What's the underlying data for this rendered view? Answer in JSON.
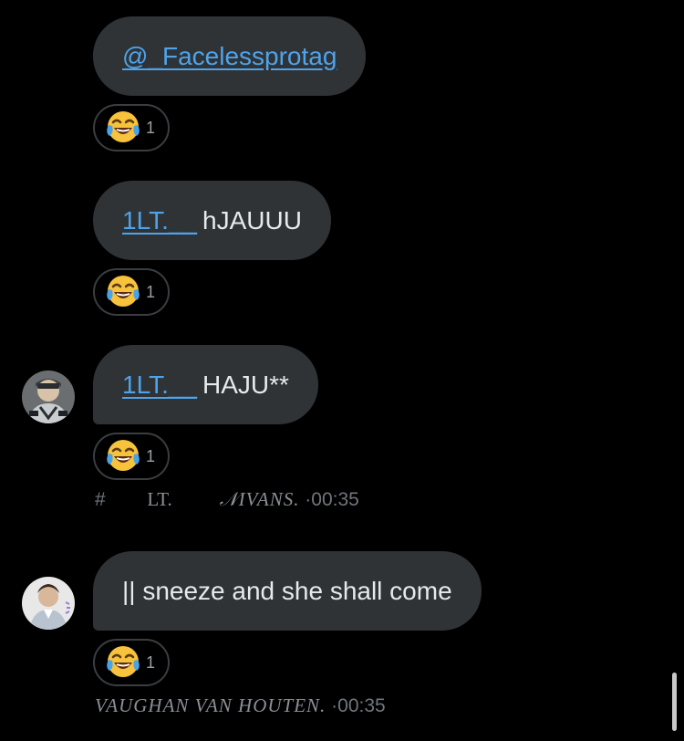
{
  "messages": [
    {
      "mention": "@_Facelessprotag",
      "text": "",
      "reaction": {
        "emoji": "😂",
        "count": "1"
      }
    },
    {
      "mention": "1LT.__",
      "text": "hJAUUU",
      "reaction": {
        "emoji": "😂",
        "count": "1"
      }
    },
    {
      "mention": "1LT.__",
      "text": "HAJU**",
      "reaction": {
        "emoji": "😂",
        "count": "1"
      },
      "meta": {
        "hash": "#",
        "lt": "LT.",
        "name": "𝒩IVANS.",
        "time": "·00:35"
      }
    },
    {
      "mention": "",
      "text": "|| sneeze and she shall come",
      "reaction": {
        "emoji": "😂",
        "count": "1"
      },
      "meta": {
        "name": "VAUGHAN VAN HOUTEN.",
        "time": "·00:35"
      }
    }
  ],
  "colors": {
    "background": "#000000",
    "bubble": "#2f3336",
    "mention": "#4ea3ea",
    "meta_text": "#71767b"
  }
}
